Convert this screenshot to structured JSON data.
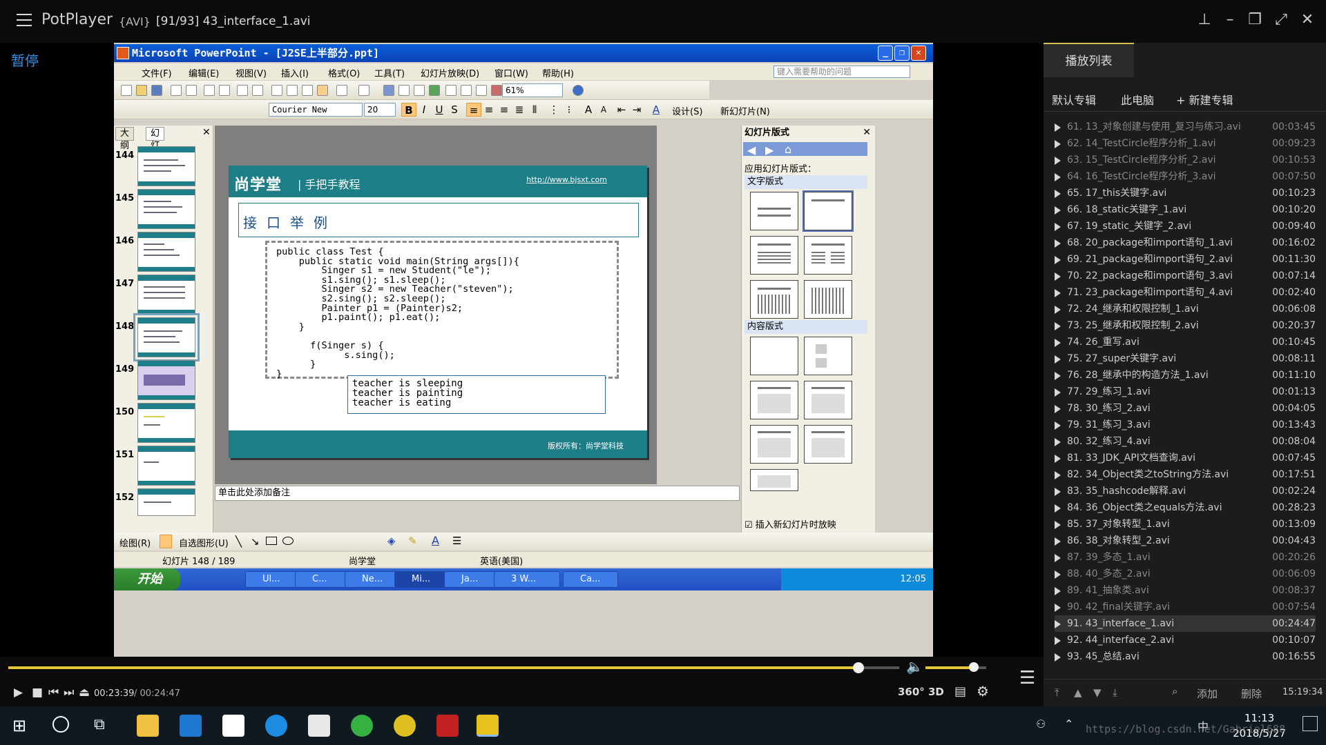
{
  "player": {
    "app_name": "PotPlayer",
    "format": "{AVI}",
    "file_title": "[91/93] 43_interface_1.avi",
    "status": "暂停",
    "current_time": "00:23:39",
    "total_time": "/ 00:24:47",
    "seek_progress": 0.954,
    "volume": 0.8,
    "btn_360": "360°",
    "btn_3d": "3D"
  },
  "ppt": {
    "window_title": "Microsoft PowerPoint - [J2SE上半部分.ppt]",
    "menus": [
      "文件(F)",
      "编辑(E)",
      "视图(V)",
      "插入(I)",
      "格式(O)",
      "工具(T)",
      "幻灯片放映(D)",
      "窗口(W)",
      "帮助(H)"
    ],
    "help_placeholder": "键入需要帮助的问题",
    "zoom": "61%",
    "font_name": "Courier New",
    "font_size": "20",
    "design_btn": "设计(S)",
    "new_slide_btn": "新幻灯片(N)",
    "tab_outline": "大纲",
    "tab_slides": "幻灯片",
    "thumb_numbers": [
      "144",
      "145",
      "146",
      "147",
      "148",
      "149",
      "150",
      "151",
      "152"
    ],
    "slide": {
      "brand": "尚学堂",
      "subtitle": "| 手把手教程",
      "url": "http://www.bjsxt.com",
      "title": "接口举例",
      "code": "public class Test {\n    public static void main(String args[]){\n        Singer s1 = new Student(\"le\");\n        s1.sing(); s1.sleep();\n        Singer s2 = new Teacher(\"steven\");\n        s2.sing(); s2.sleep();\n        Painter p1 = (Painter)s2;\n        p1.paint(); p1.eat();\n    }\n\n      f(Singer s) {\n            s.sing();\n      }\n}",
      "output": "teacher is sleeping\nteacher is painting\nteacher is eating",
      "footer": "版权所有：尚学堂科技"
    },
    "notes_placeholder": "单击此处添加备注",
    "task_pane": {
      "title": "幻灯片版式",
      "apply_label": "应用幻灯片版式：",
      "section_text": "文字版式",
      "section_content": "内容版式",
      "checkbox_label": "插入新幻灯片时放映"
    },
    "draw_label": "绘图(R)",
    "autoshape_label": "自选图形(U)",
    "status_slide": "幻灯片 148 / 189",
    "status_design": "尚学堂",
    "status_lang": "英语(美国)"
  },
  "xp_taskbar": {
    "start": "开始",
    "buttons": [
      "Ul...",
      "C...",
      "Ne...",
      "Mi...",
      "Ja...",
      "3 W...",
      "Ca..."
    ],
    "clock": "12:05"
  },
  "playlist": {
    "tab": "播放列表",
    "albums": [
      "默认专辑",
      "此电脑",
      "+ 新建专辑"
    ],
    "items": [
      {
        "name": "61. 13_对象创建与使用_复习与练习.avi",
        "dur": "00:03:45",
        "dim": true
      },
      {
        "name": "62. 14_TestCircle程序分析_1.avi",
        "dur": "00:09:23",
        "dim": true
      },
      {
        "name": "63. 15_TestCircle程序分析_2.avi",
        "dur": "00:10:53",
        "dim": true
      },
      {
        "name": "64. 16_TestCircle程序分析_3.avi",
        "dur": "00:07:50",
        "dim": true
      },
      {
        "name": "65. 17_this关键字.avi",
        "dur": "00:10:23",
        "dim": false
      },
      {
        "name": "66. 18_static关键字_1.avi",
        "dur": "00:10:20",
        "dim": false
      },
      {
        "name": "67. 19_static_关键字_2.avi",
        "dur": "00:09:40",
        "dim": false
      },
      {
        "name": "68. 20_package和import语句_1.avi",
        "dur": "00:16:02",
        "dim": false
      },
      {
        "name": "69. 21_package和import语句_2.avi",
        "dur": "00:11:30",
        "dim": false
      },
      {
        "name": "70. 22_package和import语句_3.avi",
        "dur": "00:07:14",
        "dim": false
      },
      {
        "name": "71. 23_package和import语句_4.avi",
        "dur": "00:02:40",
        "dim": false
      },
      {
        "name": "72. 24_继承和权限控制_1.avi",
        "dur": "00:06:08",
        "dim": false
      },
      {
        "name": "73. 25_继承和权限控制_2.avi",
        "dur": "00:20:37",
        "dim": false
      },
      {
        "name": "74. 26_重写.avi",
        "dur": "00:10:45",
        "dim": false
      },
      {
        "name": "75. 27_super关键字.avi",
        "dur": "00:08:11",
        "dim": false
      },
      {
        "name": "76. 28_继承中的构造方法_1.avi",
        "dur": "00:11:10",
        "dim": false
      },
      {
        "name": "77. 29_练习_1.avi",
        "dur": "00:01:13",
        "dim": false
      },
      {
        "name": "78. 30_练习_2.avi",
        "dur": "00:04:05",
        "dim": false
      },
      {
        "name": "79. 31_练习_3.avi",
        "dur": "00:13:43",
        "dim": false
      },
      {
        "name": "80. 32_练习_4.avi",
        "dur": "00:08:04",
        "dim": false
      },
      {
        "name": "81. 33_JDK_API文档查询.avi",
        "dur": "00:07:45",
        "dim": false
      },
      {
        "name": "82. 34_Object类之toString方法.avi",
        "dur": "00:17:51",
        "dim": false
      },
      {
        "name": "83. 35_hashcode解释.avi",
        "dur": "00:02:24",
        "dim": false
      },
      {
        "name": "84. 36_Object类之equals方法.avi",
        "dur": "00:28:23",
        "dim": false
      },
      {
        "name": "85. 37_对象转型_1.avi",
        "dur": "00:13:09",
        "dim": false
      },
      {
        "name": "86. 38_对象转型_2.avi",
        "dur": "00:04:43",
        "dim": false
      },
      {
        "name": "87. 39_多态_1.avi",
        "dur": "00:20:26",
        "dim": true
      },
      {
        "name": "88. 40_多态_2.avi",
        "dur": "00:06:09",
        "dim": true
      },
      {
        "name": "89. 41_抽象类.avi",
        "dur": "00:08:37",
        "dim": true
      },
      {
        "name": "90. 42_final关键字.avi",
        "dur": "00:07:54",
        "dim": true
      },
      {
        "name": "91. 43_interface_1.avi",
        "dur": "00:24:47",
        "dim": false,
        "current": true
      },
      {
        "name": "92. 44_interface_2.avi",
        "dur": "00:10:07",
        "dim": false
      },
      {
        "name": "93. 45_总结.avi",
        "dur": "00:16:55",
        "dim": false
      }
    ],
    "add_btn": "添加",
    "delete_btn": "删除",
    "time": "15:19:34"
  },
  "win_taskbar": {
    "ime": "中",
    "time": "11:13",
    "date": "2018/5/27",
    "watermark": "https://blog.csdn.net/Gabriel688"
  }
}
